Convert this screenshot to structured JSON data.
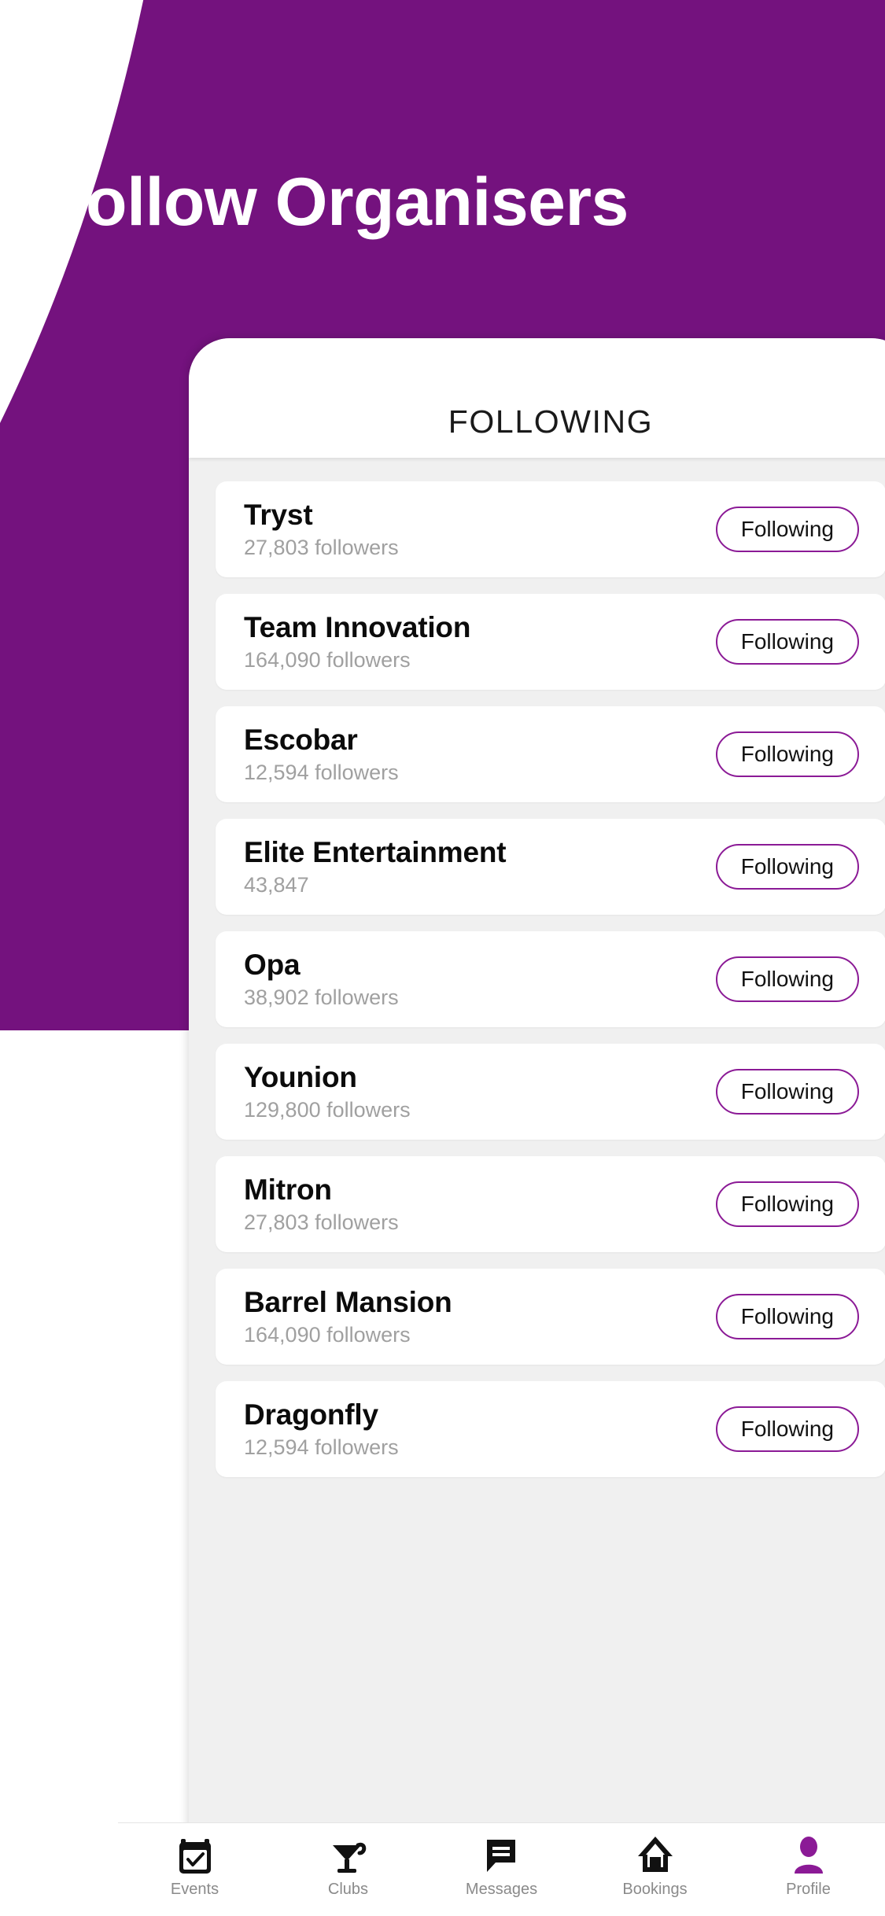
{
  "hero": {
    "title": "Follow Organisers",
    "background_color": "#74127E"
  },
  "phone": {
    "header_title": "FOLLOWING",
    "accent_color": "#8B1A96"
  },
  "list": {
    "follow_button_label": "Following",
    "items": [
      {
        "name": "Tryst",
        "followers": "27,803 followers",
        "button": "Following"
      },
      {
        "name": "Team Innovation",
        "followers": "164,090 followers",
        "button": "Following"
      },
      {
        "name": "Escobar",
        "followers": "12,594 followers",
        "button": "Following"
      },
      {
        "name": "Elite Entertainment",
        "followers": "43,847",
        "button": "Following"
      },
      {
        "name": "Opa",
        "followers": "38,902 followers",
        "button": "Following"
      },
      {
        "name": "Younion",
        "followers": "129,800 followers",
        "button": "Following"
      },
      {
        "name": "Mitron",
        "followers": "27,803 followers",
        "button": "Following"
      },
      {
        "name": "Barrel Mansion",
        "followers": "164,090 followers",
        "button": "Following"
      },
      {
        "name": "Dragonfly",
        "followers": "12,594 followers",
        "button": "Following"
      }
    ]
  },
  "bottom_nav": {
    "active": "Profile",
    "active_color": "#8B1A96",
    "items": [
      {
        "label": "Events",
        "icon": "calendar-check-icon"
      },
      {
        "label": "Clubs",
        "icon": "cocktail-glass-icon"
      },
      {
        "label": "Messages",
        "icon": "chat-bubble-icon"
      },
      {
        "label": "Bookings",
        "icon": "house-icon"
      },
      {
        "label": "Profile",
        "icon": "person-icon"
      }
    ]
  }
}
